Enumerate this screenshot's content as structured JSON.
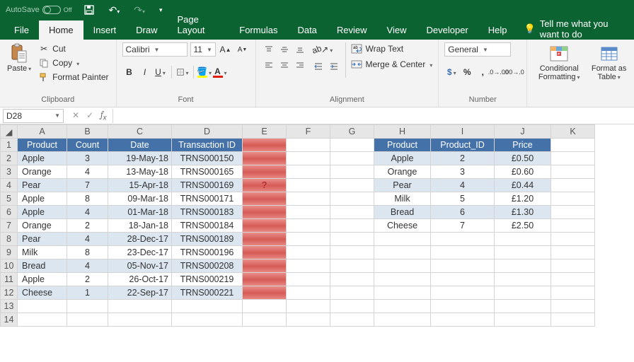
{
  "titlebar": {
    "autosave_label": "AutoSave",
    "autosave_state": "Off"
  },
  "tabs": {
    "file": "File",
    "home": "Home",
    "insert": "Insert",
    "draw": "Draw",
    "page_layout": "Page Layout",
    "formulas": "Formulas",
    "data": "Data",
    "review": "Review",
    "view": "View",
    "developer": "Developer",
    "help": "Help",
    "tell_me": "Tell me what you want to do"
  },
  "ribbon": {
    "clipboard": {
      "paste": "Paste",
      "cut": "Cut",
      "copy": "Copy",
      "format_painter": "Format Painter",
      "group": "Clipboard"
    },
    "font": {
      "name": "Calibri",
      "size": "11",
      "group": "Font"
    },
    "alignment": {
      "wrap": "Wrap Text",
      "merge": "Merge & Center",
      "group": "Alignment"
    },
    "number": {
      "format": "General",
      "group": "Number"
    },
    "styles": {
      "cond": "Conditional Formatting",
      "table": "Format as Table"
    }
  },
  "namebox": "D28",
  "columns": [
    "A",
    "B",
    "C",
    "D",
    "E",
    "F",
    "G",
    "H",
    "I",
    "J",
    "K"
  ],
  "table1": {
    "headers": [
      "Product",
      "Count",
      "Date",
      "Transaction ID"
    ],
    "rows": [
      [
        "Apple",
        "3",
        "19-May-18",
        "TRNS000150"
      ],
      [
        "Orange",
        "4",
        "13-May-18",
        "TRNS000165"
      ],
      [
        "Pear",
        "7",
        "15-Apr-18",
        "TRNS000169"
      ],
      [
        "Apple",
        "8",
        "09-Mar-18",
        "TRNS000171"
      ],
      [
        "Apple",
        "4",
        "01-Mar-18",
        "TRNS000183"
      ],
      [
        "Orange",
        "2",
        "18-Jan-18",
        "TRNS000184"
      ],
      [
        "Pear",
        "4",
        "28-Dec-17",
        "TRNS000189"
      ],
      [
        "Milk",
        "8",
        "23-Dec-17",
        "TRNS000196"
      ],
      [
        "Bread",
        "4",
        "05-Nov-17",
        "TRNS000208"
      ],
      [
        "Apple",
        "2",
        "26-Oct-17",
        "TRNS000219"
      ],
      [
        "Cheese",
        "1",
        "22-Sep-17",
        "TRNS000221"
      ]
    ]
  },
  "qmark": "?",
  "table2": {
    "headers": [
      "Product",
      "Product_ID",
      "Price"
    ],
    "rows": [
      [
        "Apple",
        "2",
        "£0.50"
      ],
      [
        "Orange",
        "3",
        "£0.60"
      ],
      [
        "Pear",
        "4",
        "£0.44"
      ],
      [
        "Milk",
        "5",
        "£1.20"
      ],
      [
        "Bread",
        "6",
        "£1.30"
      ],
      [
        "Cheese",
        "7",
        "£2.50"
      ]
    ]
  }
}
